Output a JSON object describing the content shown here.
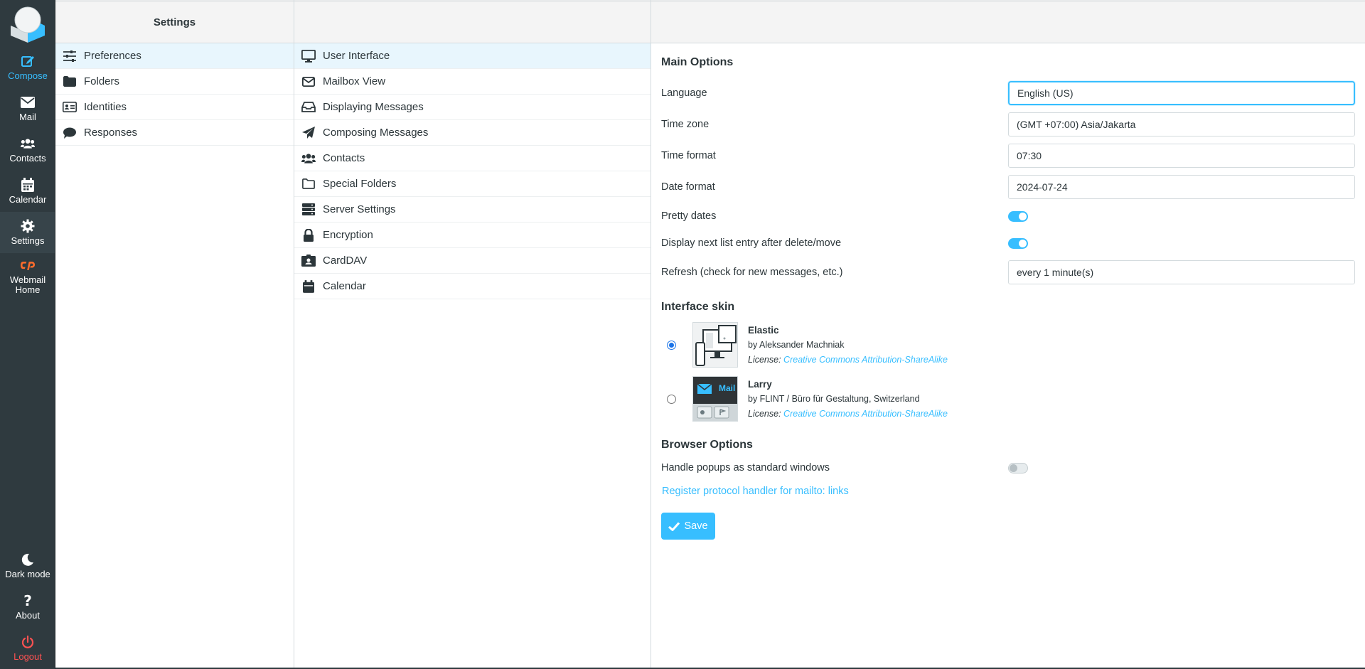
{
  "nav": {
    "compose": "Compose",
    "mail": "Mail",
    "contacts": "Contacts",
    "calendar": "Calendar",
    "settings": "Settings",
    "webmail_home_1": "Webmail",
    "webmail_home_2": "Home",
    "dark_mode": "Dark mode",
    "about": "About",
    "logout": "Logout"
  },
  "settings_panel": {
    "title": "Settings",
    "items": [
      {
        "label": "Preferences",
        "icon": "sliders-icon"
      },
      {
        "label": "Folders",
        "icon": "folder-icon"
      },
      {
        "label": "Identities",
        "icon": "id-card-icon"
      },
      {
        "label": "Responses",
        "icon": "comment-icon"
      }
    ]
  },
  "sections_panel": {
    "items": [
      {
        "label": "User Interface",
        "icon": "desktop-icon"
      },
      {
        "label": "Mailbox View",
        "icon": "envelope-icon"
      },
      {
        "label": "Displaying Messages",
        "icon": "inbox-icon"
      },
      {
        "label": "Composing Messages",
        "icon": "paper-plane-icon"
      },
      {
        "label": "Contacts",
        "icon": "users-icon"
      },
      {
        "label": "Special Folders",
        "icon": "folder-outline-icon"
      },
      {
        "label": "Server Settings",
        "icon": "server-icon"
      },
      {
        "label": "Encryption",
        "icon": "lock-icon"
      },
      {
        "label": "CardDAV",
        "icon": "address-card-icon"
      },
      {
        "label": "Calendar",
        "icon": "calendar-icon"
      }
    ]
  },
  "main_options": {
    "title": "Main Options",
    "language_label": "Language",
    "language_value": "English (US)",
    "timezone_label": "Time zone",
    "timezone_value": "(GMT +07:00) Asia/Jakarta",
    "time_format_label": "Time format",
    "time_format_value": "07:30",
    "date_format_label": "Date format",
    "date_format_value": "2024-07-24",
    "pretty_dates_label": "Pretty dates",
    "pretty_dates_on": true,
    "next_entry_label": "Display next list entry after delete/move",
    "next_entry_on": true,
    "refresh_label": "Refresh (check for new messages, etc.)",
    "refresh_value": "every 1 minute(s)"
  },
  "interface_skin": {
    "title": "Interface skin",
    "skins": [
      {
        "name": "Elastic",
        "author": "by Aleksander Machniak",
        "license_prefix": "License:",
        "license": "Creative Commons Attribution-ShareAlike",
        "selected": true
      },
      {
        "name": "Larry",
        "author": "by FLINT / Büro für Gestaltung, Switzerland",
        "license_prefix": "License:",
        "license": "Creative Commons Attribution-ShareAlike",
        "selected": false,
        "thumb_text": "Mail"
      }
    ]
  },
  "browser_options": {
    "title": "Browser Options",
    "popups_label": "Handle popups as standard windows",
    "popups_on": false,
    "protocol_link": "Register protocol handler for mailto: links"
  },
  "save_label": "Save",
  "colors": {
    "accent": "#37beff",
    "nav_bg": "#2f3a3f",
    "logout": "#ff5252"
  }
}
